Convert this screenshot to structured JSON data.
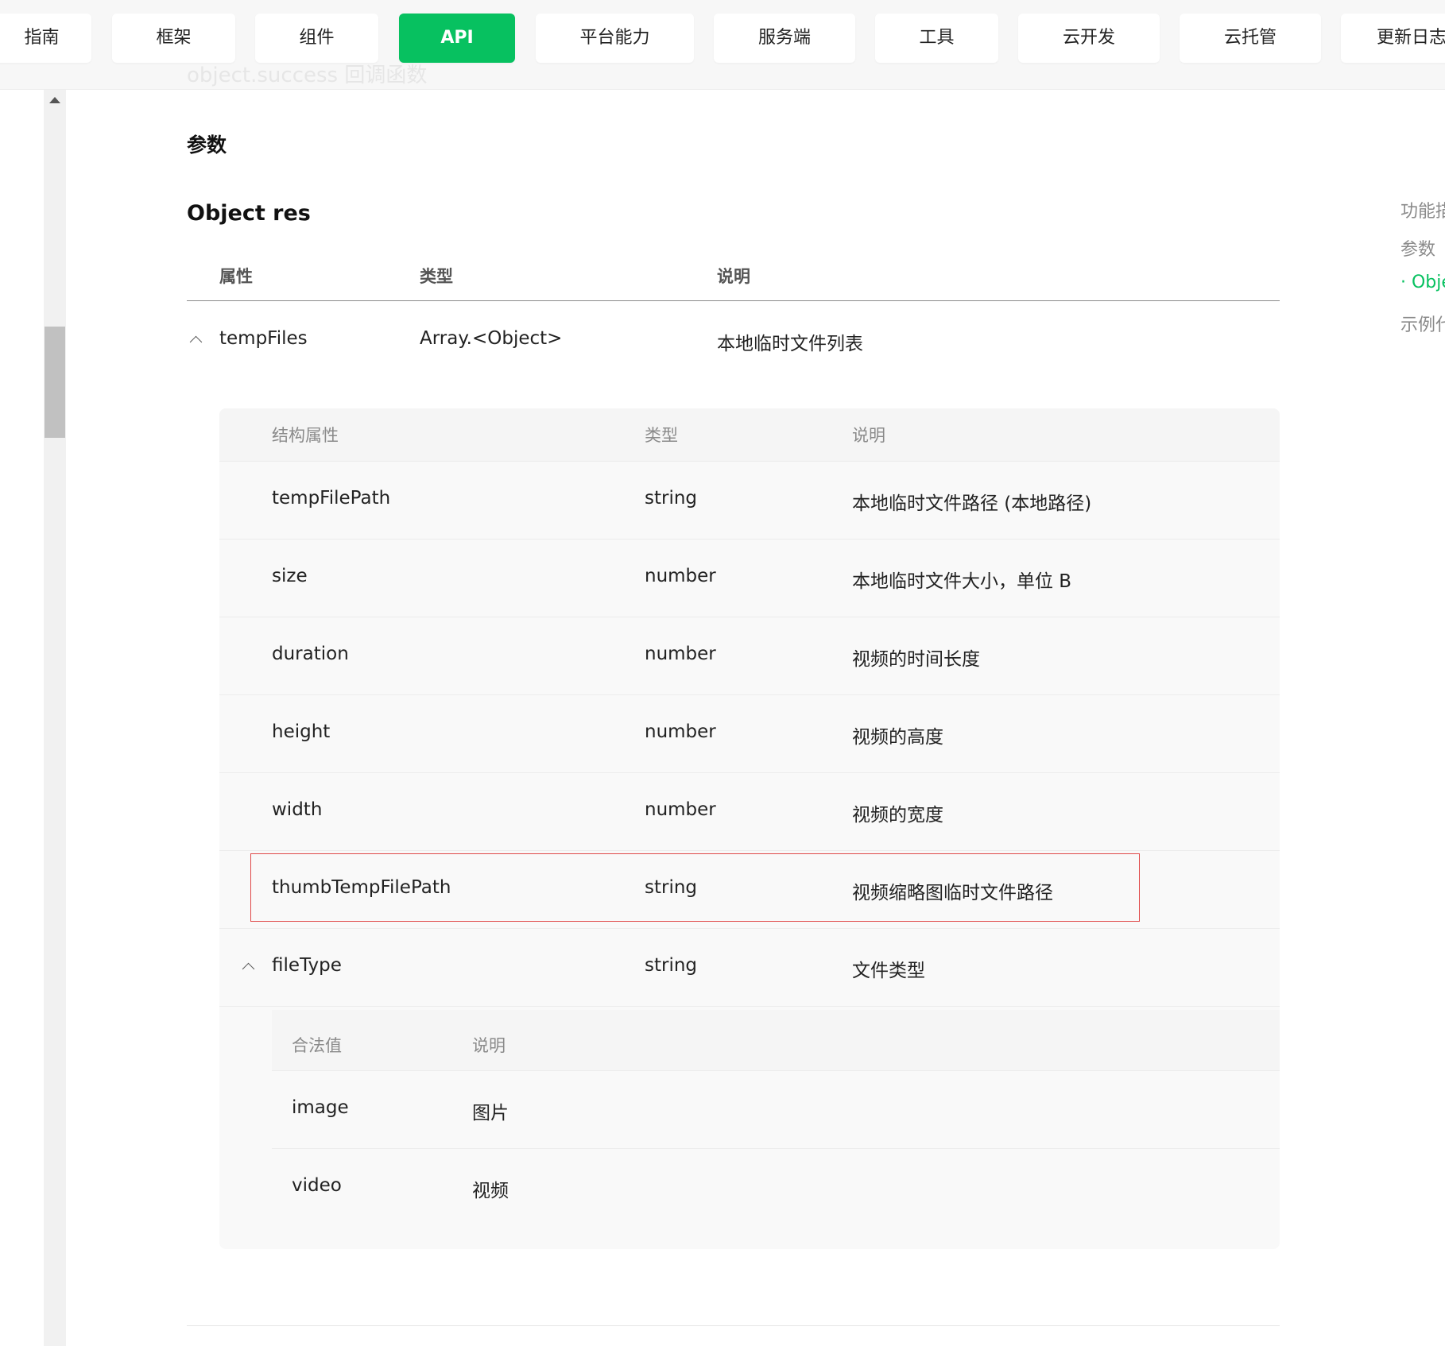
{
  "nav": {
    "tabs": [
      "指南",
      "框架",
      "组件",
      "API",
      "平台能力",
      "服务端",
      "工具",
      "云开发",
      "云托管",
      "更新日志"
    ],
    "active": "API"
  },
  "content": {
    "faded_heading": "object.success 回调函数",
    "params_heading": "参数",
    "object_heading": "Object res",
    "outer_table": {
      "headers": [
        "属性",
        "类型",
        "说明"
      ],
      "row": {
        "name": "tempFiles",
        "type": "Array.<Object>",
        "desc": "本地临时文件列表"
      }
    },
    "inner_table": {
      "headers": [
        "结构属性",
        "类型",
        "说明"
      ],
      "rows": [
        {
          "name": "tempFilePath",
          "type": "string",
          "desc": "本地临时文件路径 (本地路径)"
        },
        {
          "name": "size",
          "type": "number",
          "desc": "本地临时文件大小，单位 B"
        },
        {
          "name": "duration",
          "type": "number",
          "desc": "视频的时间长度"
        },
        {
          "name": "height",
          "type": "number",
          "desc": "视频的高度"
        },
        {
          "name": "width",
          "type": "number",
          "desc": "视频的宽度"
        },
        {
          "name": "thumbTempFilePath",
          "type": "string",
          "desc": "视频缩略图临时文件路径"
        },
        {
          "name": "fileType",
          "type": "string",
          "desc": "文件类型"
        }
      ]
    },
    "filetype_values": {
      "headers": [
        "合法值",
        "说明"
      ],
      "rows": [
        {
          "value": "image",
          "desc": "图片"
        },
        {
          "value": "video",
          "desc": "视频"
        }
      ]
    }
  },
  "toc": {
    "items": [
      "功能描述",
      "参数",
      "· Object res",
      "示例代码"
    ],
    "active_index": 2
  },
  "colors": {
    "accent": "#07c160",
    "highlight_border": "#e04848"
  }
}
